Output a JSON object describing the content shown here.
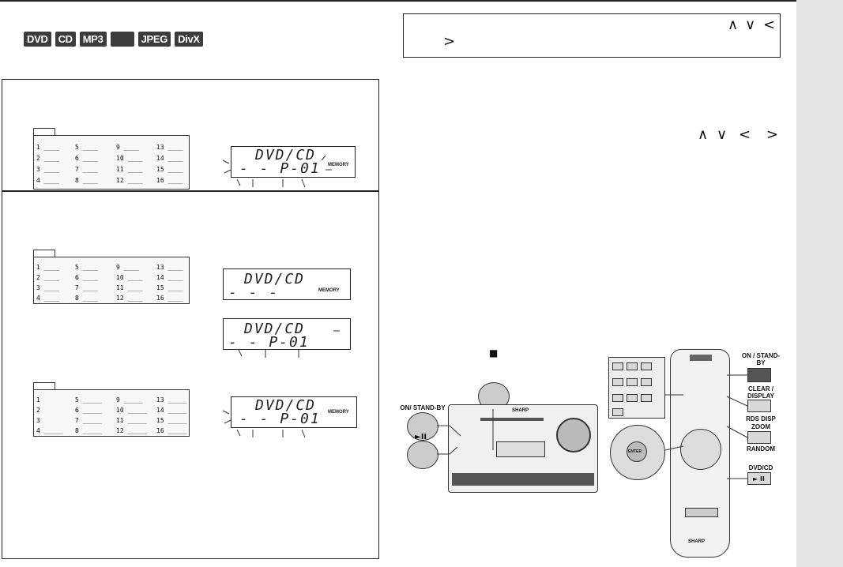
{
  "badges": [
    "DVD",
    "CD",
    "MP3",
    "",
    "JPEG",
    "DivX"
  ],
  "arrows": {
    "up": "∧",
    "down": "∨",
    "left": "<",
    "right": ">"
  },
  "program_table": {
    "entries": [
      "1",
      "2",
      "3",
      "4",
      "5",
      "6",
      "7",
      "8",
      "9",
      "10",
      "11",
      "12",
      "13",
      "14",
      "15",
      "16"
    ]
  },
  "lcd": {
    "line1": "DVD/CD",
    "line2_full": "- -  P-01",
    "line2_short": "- - -",
    "memory": "MEMORY"
  },
  "player": {
    "stop_symbol": "■",
    "play_pause_symbol": "►II",
    "on_standby": "ON/ STAND-BY",
    "brand": "SHARP"
  },
  "remote_labels": {
    "on_standby": "ON / STAND-BY",
    "clear_display": "CLEAR / DISPLAY",
    "rds_disp": "RDS DISP",
    "zoom": "ZOOM",
    "random": "RANDOM",
    "dvd_cd": "DVD/CD",
    "play_pause": "► II",
    "enter": "ENTER",
    "brand": "SHARP"
  }
}
